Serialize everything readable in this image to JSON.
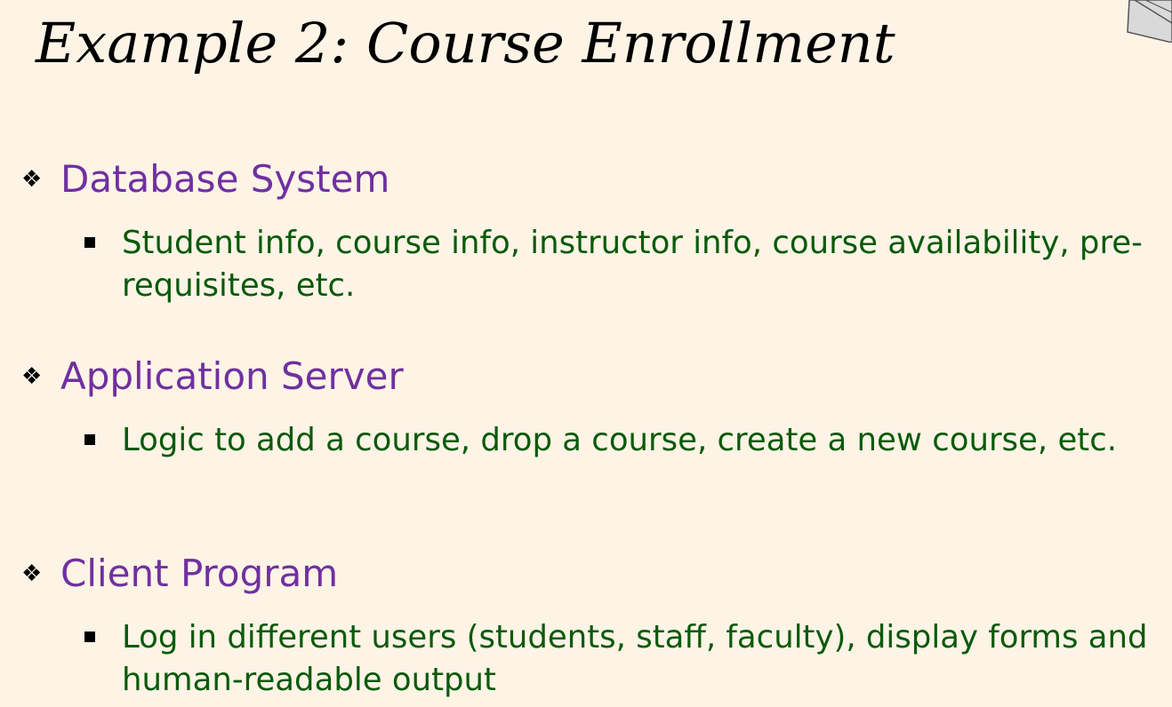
{
  "slide": {
    "title": "Example 2: Course Enrollment",
    "bullet_symbol": "❖",
    "corner_icon": "folded-page-corner-icon",
    "colors": {
      "background": "#fdf4e6",
      "heading": "#7030a0",
      "subtext": "#0b5a0b",
      "title": "#000000"
    },
    "sections": [
      {
        "heading": "Database System",
        "detail": "Student info, course info, instructor info, course availability, pre-requisites, etc."
      },
      {
        "heading": "Application Server",
        "detail": "Logic to add a course, drop a course, create a new course, etc."
      },
      {
        "heading": "Client Program",
        "detail": "Log in different users (students, staff, faculty), display forms and human-readable output"
      }
    ]
  }
}
